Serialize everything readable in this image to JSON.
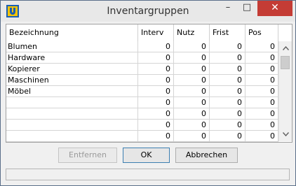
{
  "window": {
    "title": "Inventargruppen"
  },
  "titlebar": {
    "minimize_icon": "minimize-icon",
    "maximize_icon": "maximize-icon",
    "close_icon": "close-icon",
    "minimize_glyph": "–",
    "maximize_glyph": "□",
    "close_glyph": "✕"
  },
  "grid": {
    "columns": [
      "Bezeichnung",
      "Interv",
      "Nutz",
      "Frist",
      "Pos"
    ],
    "rows": [
      [
        "Blumen",
        "0",
        "0",
        "0",
        "0"
      ],
      [
        "Hardware",
        "0",
        "0",
        "0",
        "0"
      ],
      [
        "Kopierer",
        "0",
        "0",
        "0",
        "0"
      ],
      [
        "Maschinen",
        "0",
        "0",
        "0",
        "0"
      ],
      [
        "Möbel",
        "0",
        "0",
        "0",
        "0"
      ],
      [
        "",
        "0",
        "0",
        "0",
        "0"
      ],
      [
        "",
        "0",
        "0",
        "0",
        "0"
      ],
      [
        "",
        "0",
        "0",
        "0",
        "0"
      ],
      [
        "",
        "0",
        "0",
        "0",
        "0"
      ]
    ]
  },
  "scrollbar": {
    "up_glyph": "^",
    "down_glyph": "v"
  },
  "buttons": {
    "remove": "Entfernen",
    "ok": "OK",
    "cancel": "Abbrechen"
  },
  "statusbar": {
    "text": ""
  }
}
